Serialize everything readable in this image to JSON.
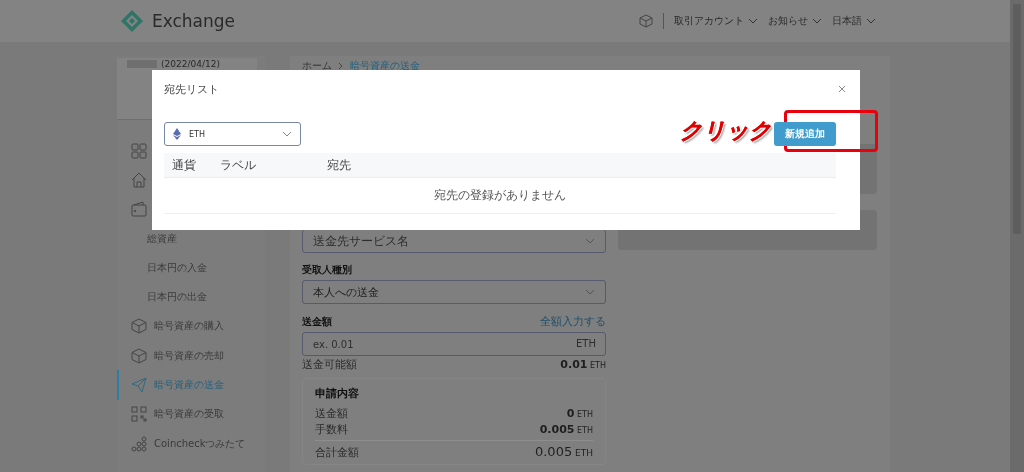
{
  "header": {
    "logo_text": "Exchange",
    "menus": [
      {
        "label": "取引アカウント"
      },
      {
        "label": "お知らせ"
      },
      {
        "label": "日本語"
      }
    ]
  },
  "sidebar": {
    "date": "(2022/04/12)",
    "items": [
      {
        "kind": "icon_only",
        "selected": false
      },
      {
        "kind": "icon_only",
        "selected": false
      },
      {
        "kind": "icon_only",
        "selected": false
      },
      {
        "kind": "sub",
        "label": "総資産",
        "selected": false
      },
      {
        "kind": "sub",
        "label": "日本円の入金",
        "selected": false
      },
      {
        "kind": "sub",
        "label": "日本円の出金",
        "selected": false
      },
      {
        "kind": "main",
        "label": "暗号資産の購入",
        "selected": false
      },
      {
        "kind": "main",
        "label": "暗号資産の売却",
        "selected": false
      },
      {
        "kind": "main",
        "label": "暗号資産の送金",
        "selected": true
      },
      {
        "kind": "main",
        "label": "暗号資産の受取",
        "selected": false
      },
      {
        "kind": "main",
        "label": "Coincheckつみたて",
        "selected": false
      }
    ]
  },
  "breadcrumb": [
    {
      "label": "ホーム",
      "selected": false
    },
    {
      "label": "暗号資産の送金",
      "selected": true
    }
  ],
  "form": {
    "service_select": {
      "placeholder": "送金先サービス名"
    },
    "recipient_type": {
      "label": "受取人種別",
      "value": "本人への送金"
    },
    "amount": {
      "label": "送金額",
      "link": "全額入力する",
      "placeholder": "ex. 0.01",
      "unit": "ETH"
    },
    "available": {
      "label": "送金可能額",
      "value": "0.01",
      "unit": "ETH"
    },
    "summary": {
      "title": "申請内容",
      "rows": [
        {
          "label": "送金額",
          "value": "0",
          "unit": "ETH"
        },
        {
          "label": "手数料",
          "value": "0.005",
          "unit": "ETH"
        }
      ],
      "total": {
        "label": "合計金額",
        "value": "0.005",
        "unit": "ETH"
      }
    }
  },
  "modal": {
    "title": "宛先リスト",
    "currency_select": {
      "value": "ETH"
    },
    "columns": [
      "通貨",
      "ラベル",
      "宛先"
    ],
    "empty_message": "宛先の登録がありません",
    "add_button": "新規追加"
  },
  "annotation": {
    "text": "クリック"
  }
}
